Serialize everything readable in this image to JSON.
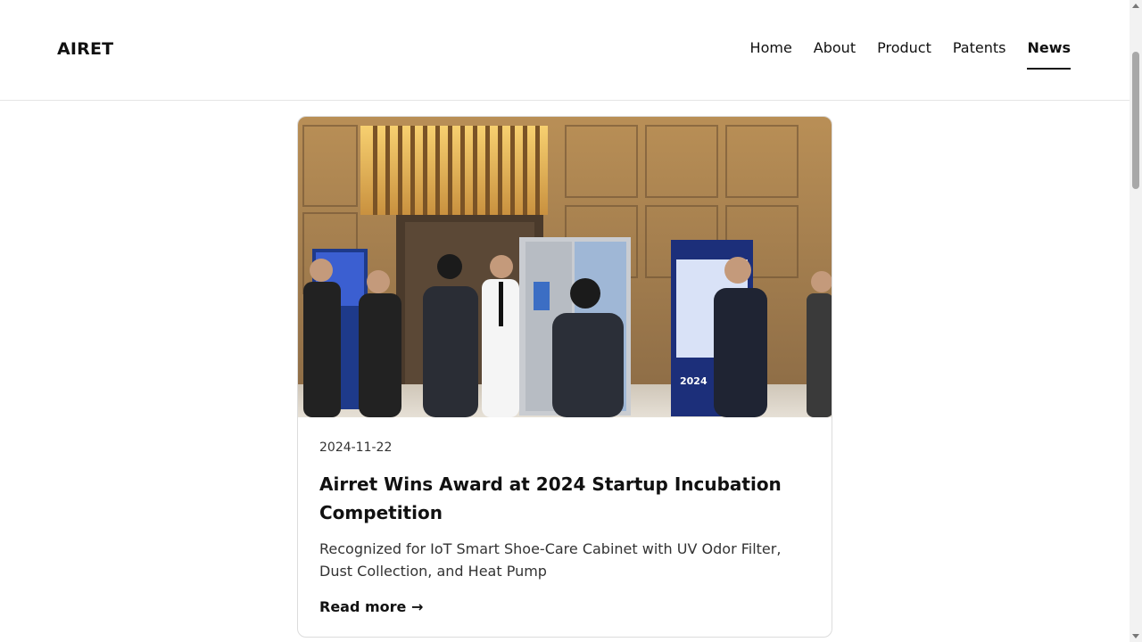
{
  "brand": "AIRET",
  "nav": {
    "items": [
      "Home",
      "About",
      "Product",
      "Patents",
      "News"
    ],
    "active": "News"
  },
  "article": {
    "date": "2024-11-22",
    "title": "Airret Wins Award at 2024 Startup Incubation Competition",
    "description": "Recognized for IoT Smart Shoe-Care Cabinet with UV Odor Filter, Dust Collection, and Heat Pump",
    "read_more": "Read more →",
    "banner_left": "",
    "banner_right_year": "2024"
  },
  "colors": {
    "text": "#111111",
    "border": "#dcdcdc",
    "accent": "#111111"
  }
}
